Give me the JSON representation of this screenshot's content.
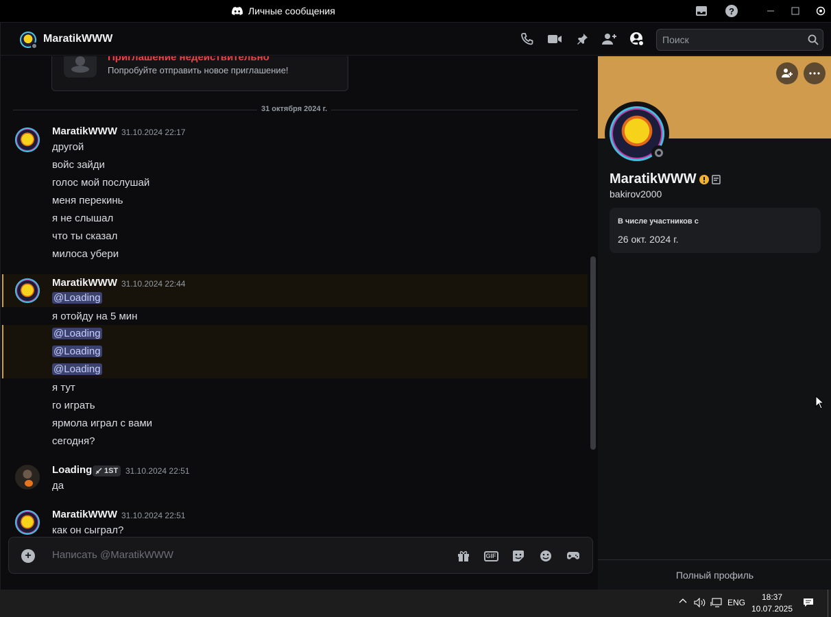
{
  "window": {
    "title": "Личные сообщения"
  },
  "header": {
    "name": "MaratikWWW",
    "search_placeholder": "Поиск"
  },
  "invite": {
    "title": "Приглашение недействительно",
    "subtitle": "Попробуйте отправить новое приглашение!"
  },
  "date_divider": "31 октября 2024 г.",
  "messages": [
    {
      "author": "MaratikWWW",
      "timestamp": "31.10.2024 22:17",
      "lines": [
        "другой",
        "войс зайди",
        "голос мой послушай",
        "меня перекинь",
        "я не слышал",
        "что ты сказал",
        "милоса убери"
      ]
    },
    {
      "author": "MaratikWWW",
      "timestamp": "31.10.2024 22:44",
      "lines": [
        "@Loading",
        "я отойду на 5 мин",
        "@Loading",
        "@Loading",
        "@Loading",
        "я тут",
        "го играть",
        "ярмола играл с вами",
        "сегодня?"
      ]
    },
    {
      "author": "Loading",
      "role_badge": "1ST",
      "timestamp": "31.10.2024 22:51",
      "lines": [
        "да"
      ]
    },
    {
      "author": "MaratikWWW",
      "timestamp": "31.10.2024 22:51",
      "lines": [
        "как он сыграл?"
      ]
    }
  ],
  "composer": {
    "placeholder": "Написать @MaratikWWW",
    "gif_label": "GIF"
  },
  "profile": {
    "display_name": "MaratikWWW",
    "username": "bakirov2000",
    "member_label": "В числе участников с",
    "member_since": "26 окт. 2024 г.",
    "full_profile_label": "Полный профиль",
    "banner_color": "#d09b4c"
  },
  "taskbar": {
    "language": "ENG",
    "time": "18:37",
    "date": "10.07.2025"
  },
  "colors": {
    "mention_bg": "#3c4270",
    "highlight_border": "#c9a227",
    "error_red": "#f23f43"
  }
}
